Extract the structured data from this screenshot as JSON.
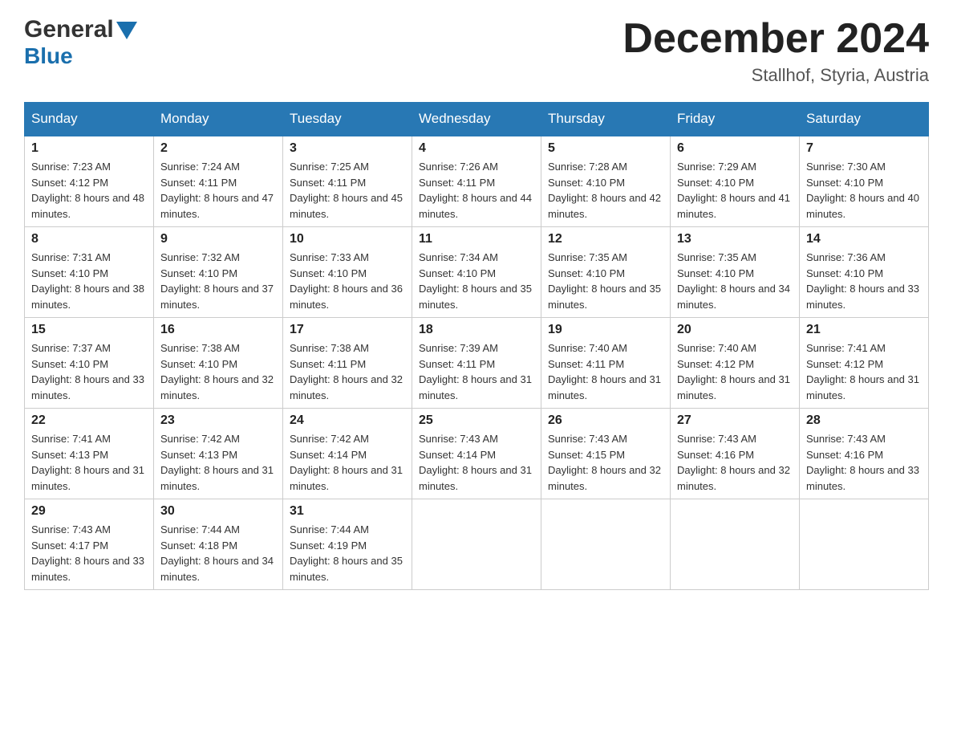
{
  "header": {
    "logo_general": "General",
    "logo_blue": "Blue",
    "month_title": "December 2024",
    "location": "Stallhof, Styria, Austria"
  },
  "calendar": {
    "days_of_week": [
      "Sunday",
      "Monday",
      "Tuesday",
      "Wednesday",
      "Thursday",
      "Friday",
      "Saturday"
    ],
    "weeks": [
      [
        {
          "day": "1",
          "sunrise": "Sunrise: 7:23 AM",
          "sunset": "Sunset: 4:12 PM",
          "daylight": "Daylight: 8 hours and 48 minutes."
        },
        {
          "day": "2",
          "sunrise": "Sunrise: 7:24 AM",
          "sunset": "Sunset: 4:11 PM",
          "daylight": "Daylight: 8 hours and 47 minutes."
        },
        {
          "day": "3",
          "sunrise": "Sunrise: 7:25 AM",
          "sunset": "Sunset: 4:11 PM",
          "daylight": "Daylight: 8 hours and 45 minutes."
        },
        {
          "day": "4",
          "sunrise": "Sunrise: 7:26 AM",
          "sunset": "Sunset: 4:11 PM",
          "daylight": "Daylight: 8 hours and 44 minutes."
        },
        {
          "day": "5",
          "sunrise": "Sunrise: 7:28 AM",
          "sunset": "Sunset: 4:10 PM",
          "daylight": "Daylight: 8 hours and 42 minutes."
        },
        {
          "day": "6",
          "sunrise": "Sunrise: 7:29 AM",
          "sunset": "Sunset: 4:10 PM",
          "daylight": "Daylight: 8 hours and 41 minutes."
        },
        {
          "day": "7",
          "sunrise": "Sunrise: 7:30 AM",
          "sunset": "Sunset: 4:10 PM",
          "daylight": "Daylight: 8 hours and 40 minutes."
        }
      ],
      [
        {
          "day": "8",
          "sunrise": "Sunrise: 7:31 AM",
          "sunset": "Sunset: 4:10 PM",
          "daylight": "Daylight: 8 hours and 38 minutes."
        },
        {
          "day": "9",
          "sunrise": "Sunrise: 7:32 AM",
          "sunset": "Sunset: 4:10 PM",
          "daylight": "Daylight: 8 hours and 37 minutes."
        },
        {
          "day": "10",
          "sunrise": "Sunrise: 7:33 AM",
          "sunset": "Sunset: 4:10 PM",
          "daylight": "Daylight: 8 hours and 36 minutes."
        },
        {
          "day": "11",
          "sunrise": "Sunrise: 7:34 AM",
          "sunset": "Sunset: 4:10 PM",
          "daylight": "Daylight: 8 hours and 35 minutes."
        },
        {
          "day": "12",
          "sunrise": "Sunrise: 7:35 AM",
          "sunset": "Sunset: 4:10 PM",
          "daylight": "Daylight: 8 hours and 35 minutes."
        },
        {
          "day": "13",
          "sunrise": "Sunrise: 7:35 AM",
          "sunset": "Sunset: 4:10 PM",
          "daylight": "Daylight: 8 hours and 34 minutes."
        },
        {
          "day": "14",
          "sunrise": "Sunrise: 7:36 AM",
          "sunset": "Sunset: 4:10 PM",
          "daylight": "Daylight: 8 hours and 33 minutes."
        }
      ],
      [
        {
          "day": "15",
          "sunrise": "Sunrise: 7:37 AM",
          "sunset": "Sunset: 4:10 PM",
          "daylight": "Daylight: 8 hours and 33 minutes."
        },
        {
          "day": "16",
          "sunrise": "Sunrise: 7:38 AM",
          "sunset": "Sunset: 4:10 PM",
          "daylight": "Daylight: 8 hours and 32 minutes."
        },
        {
          "day": "17",
          "sunrise": "Sunrise: 7:38 AM",
          "sunset": "Sunset: 4:11 PM",
          "daylight": "Daylight: 8 hours and 32 minutes."
        },
        {
          "day": "18",
          "sunrise": "Sunrise: 7:39 AM",
          "sunset": "Sunset: 4:11 PM",
          "daylight": "Daylight: 8 hours and 31 minutes."
        },
        {
          "day": "19",
          "sunrise": "Sunrise: 7:40 AM",
          "sunset": "Sunset: 4:11 PM",
          "daylight": "Daylight: 8 hours and 31 minutes."
        },
        {
          "day": "20",
          "sunrise": "Sunrise: 7:40 AM",
          "sunset": "Sunset: 4:12 PM",
          "daylight": "Daylight: 8 hours and 31 minutes."
        },
        {
          "day": "21",
          "sunrise": "Sunrise: 7:41 AM",
          "sunset": "Sunset: 4:12 PM",
          "daylight": "Daylight: 8 hours and 31 minutes."
        }
      ],
      [
        {
          "day": "22",
          "sunrise": "Sunrise: 7:41 AM",
          "sunset": "Sunset: 4:13 PM",
          "daylight": "Daylight: 8 hours and 31 minutes."
        },
        {
          "day": "23",
          "sunrise": "Sunrise: 7:42 AM",
          "sunset": "Sunset: 4:13 PM",
          "daylight": "Daylight: 8 hours and 31 minutes."
        },
        {
          "day": "24",
          "sunrise": "Sunrise: 7:42 AM",
          "sunset": "Sunset: 4:14 PM",
          "daylight": "Daylight: 8 hours and 31 minutes."
        },
        {
          "day": "25",
          "sunrise": "Sunrise: 7:43 AM",
          "sunset": "Sunset: 4:14 PM",
          "daylight": "Daylight: 8 hours and 31 minutes."
        },
        {
          "day": "26",
          "sunrise": "Sunrise: 7:43 AM",
          "sunset": "Sunset: 4:15 PM",
          "daylight": "Daylight: 8 hours and 32 minutes."
        },
        {
          "day": "27",
          "sunrise": "Sunrise: 7:43 AM",
          "sunset": "Sunset: 4:16 PM",
          "daylight": "Daylight: 8 hours and 32 minutes."
        },
        {
          "day": "28",
          "sunrise": "Sunrise: 7:43 AM",
          "sunset": "Sunset: 4:16 PM",
          "daylight": "Daylight: 8 hours and 33 minutes."
        }
      ],
      [
        {
          "day": "29",
          "sunrise": "Sunrise: 7:43 AM",
          "sunset": "Sunset: 4:17 PM",
          "daylight": "Daylight: 8 hours and 33 minutes."
        },
        {
          "day": "30",
          "sunrise": "Sunrise: 7:44 AM",
          "sunset": "Sunset: 4:18 PM",
          "daylight": "Daylight: 8 hours and 34 minutes."
        },
        {
          "day": "31",
          "sunrise": "Sunrise: 7:44 AM",
          "sunset": "Sunset: 4:19 PM",
          "daylight": "Daylight: 8 hours and 35 minutes."
        },
        null,
        null,
        null,
        null
      ]
    ]
  }
}
